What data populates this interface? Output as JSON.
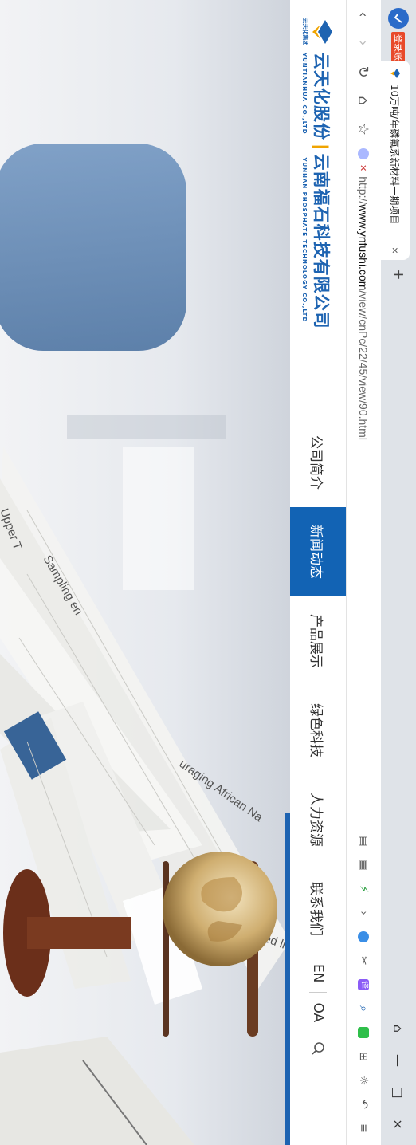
{
  "browser": {
    "login_badge": "登录账号",
    "tab": {
      "title": "10万吨/年磷氟系新材料一期项目",
      "close": "×"
    },
    "new_tab": "+",
    "window": {
      "restore": "⌂",
      "minimize": "—",
      "maximize": "□",
      "close": "×"
    },
    "nav": {
      "back": "‹",
      "forward": "›",
      "reload": "↻",
      "home": "⌂",
      "star": "☆"
    },
    "url": {
      "scheme": "http://",
      "host": "www.ynfushi.com",
      "path": "/view/cnPc/22/45/view/90.html"
    },
    "tools": {
      "expand": "›",
      "translate": "译",
      "search": "⌕",
      "apps": "⊞",
      "theme": "☼",
      "undo": "↶",
      "menu": "≡"
    }
  },
  "site": {
    "logo": {
      "mark_sub": "云天化集团",
      "name": "云天化股份",
      "separator": "|",
      "company": "云南福石科技有限公司",
      "en_left": "YUNTIANHUA CO.,LTD",
      "en_right": "YUNNAN PHOSPHATE TECHNOLOGY CO.,LTD"
    },
    "menu": {
      "about": "公司简介",
      "news": "新闻动态",
      "products": "产品展示",
      "green": "绿色科技",
      "hr": "人力资源",
      "contact": "联系我们",
      "en": "EN",
      "oa": "OA"
    }
  },
  "banner": {
    "paper_texts": [
      "ger granted licen",
      "uraging African Na",
      "Sampling en",
      "Upper T"
    ]
  },
  "colors": {
    "brand": "#1d63b1",
    "active_menu": "#1263b4",
    "accent_sep": "#f0a400"
  }
}
